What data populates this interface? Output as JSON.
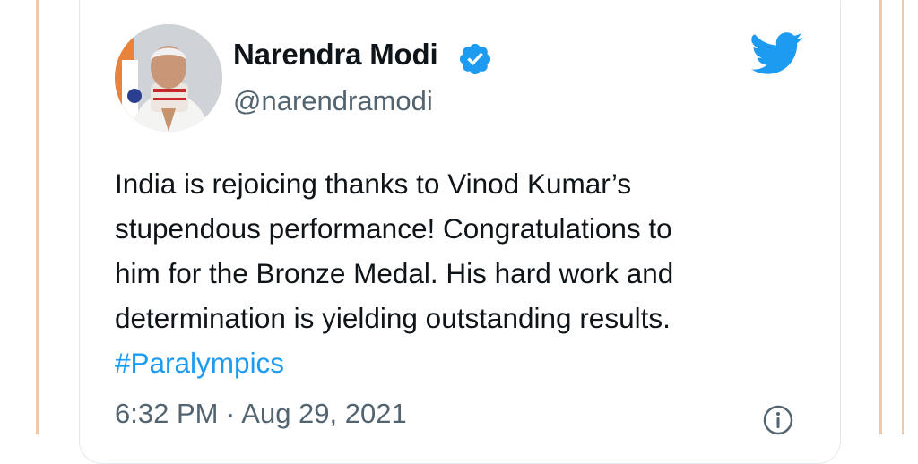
{
  "author": {
    "display_name": "Narendra Modi",
    "handle": "@narendramodi",
    "avatar_icon": "profile-photo",
    "verified_icon": "verified-badge-icon",
    "verified_color": "#1d9bf0"
  },
  "brand": {
    "logo_icon": "twitter-bird-icon",
    "color": "#1d9bf0"
  },
  "tweet": {
    "lines": [
      "India is rejoicing thanks to Vinod Kumar’s",
      "stupendous performance! Congratulations to",
      "him for the Bronze Medal. His hard work and",
      "determination is yielding outstanding results."
    ],
    "hashtag": "#Paralympics",
    "timestamp": "6:32 PM · Aug 29, 2021"
  },
  "actions": {
    "info_icon": "info-icon"
  }
}
